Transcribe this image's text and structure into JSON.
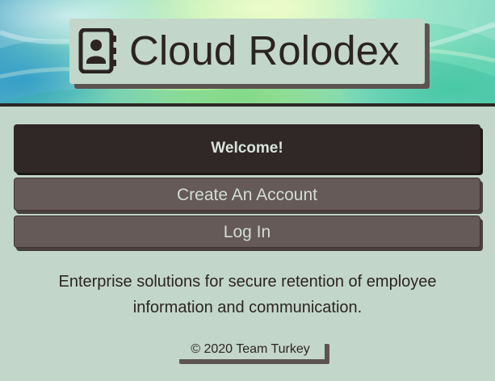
{
  "header": {
    "title": "Cloud Rolodex",
    "logo_icon": "address-book-icon"
  },
  "main": {
    "welcome_label": "Welcome!",
    "create_account_label": "Create An Account",
    "login_label": "Log In",
    "tagline_line1": "Enterprise solutions for secure retention of employee",
    "tagline_line2": "information and communication."
  },
  "footer": {
    "copyright": "© 2020 Team Turkey"
  },
  "colors": {
    "background": "#c3d6ca",
    "dark": "#2f2827",
    "button": "#655a58",
    "button_text": "#d3ddd6"
  }
}
